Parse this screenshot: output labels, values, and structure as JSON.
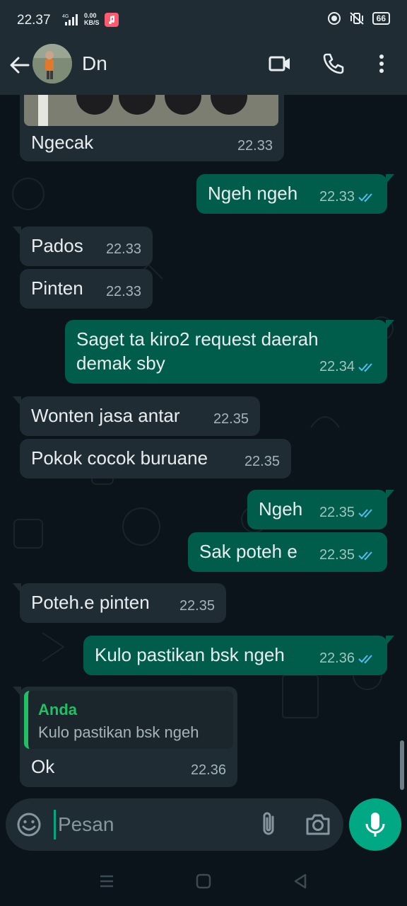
{
  "status_bar": {
    "time": "22.37",
    "network": "4G",
    "speed_value": "0.00",
    "speed_unit": "KB/S",
    "battery": "66"
  },
  "header": {
    "contact_name": "Dn",
    "icons": [
      "back-arrow-icon",
      "video-call-icon",
      "phone-icon",
      "more-vert-icon"
    ]
  },
  "messages": [
    {
      "dir": "in",
      "text": "Ngecak",
      "time": "22.33",
      "has_image": true
    },
    {
      "dir": "out",
      "text": "Ngeh ngeh",
      "time": "22.33",
      "read": true
    },
    {
      "dir": "in",
      "text": "Pados",
      "time": "22.33"
    },
    {
      "dir": "in",
      "text": "Pinten",
      "time": "22.33"
    },
    {
      "dir": "out",
      "text_line1": "Saget ta kiro2 request daerah",
      "text_line2": "demak sby",
      "time": "22.34",
      "read": true
    },
    {
      "dir": "in",
      "text": "Wonten jasa antar",
      "time": "22.35"
    },
    {
      "dir": "in",
      "text": "Pokok cocok buruane",
      "time": "22.35"
    },
    {
      "dir": "out",
      "text": "Ngeh",
      "time": "22.35",
      "read": true
    },
    {
      "dir": "out",
      "text": "Sak poteh e",
      "time": "22.35",
      "read": true
    },
    {
      "dir": "in",
      "text": "Poteh.e pinten",
      "time": "22.35"
    },
    {
      "dir": "out",
      "text": "Kulo pastikan bsk ngeh",
      "time": "22.36",
      "read": true
    },
    {
      "dir": "in",
      "text": "Ok",
      "time": "22.36",
      "quote": {
        "author": "Anda",
        "text": "Kulo pastikan bsk ngeh"
      }
    }
  ],
  "composer": {
    "placeholder": "Pesan",
    "icons": [
      "emoji-icon",
      "attach-icon",
      "camera-icon",
      "mic-icon"
    ]
  },
  "colors": {
    "background": "#0b141a",
    "incoming_bubble": "#1f2c34",
    "outgoing_bubble": "#005c4b",
    "accent": "#00a884",
    "read_tick": "#53bdeb"
  }
}
